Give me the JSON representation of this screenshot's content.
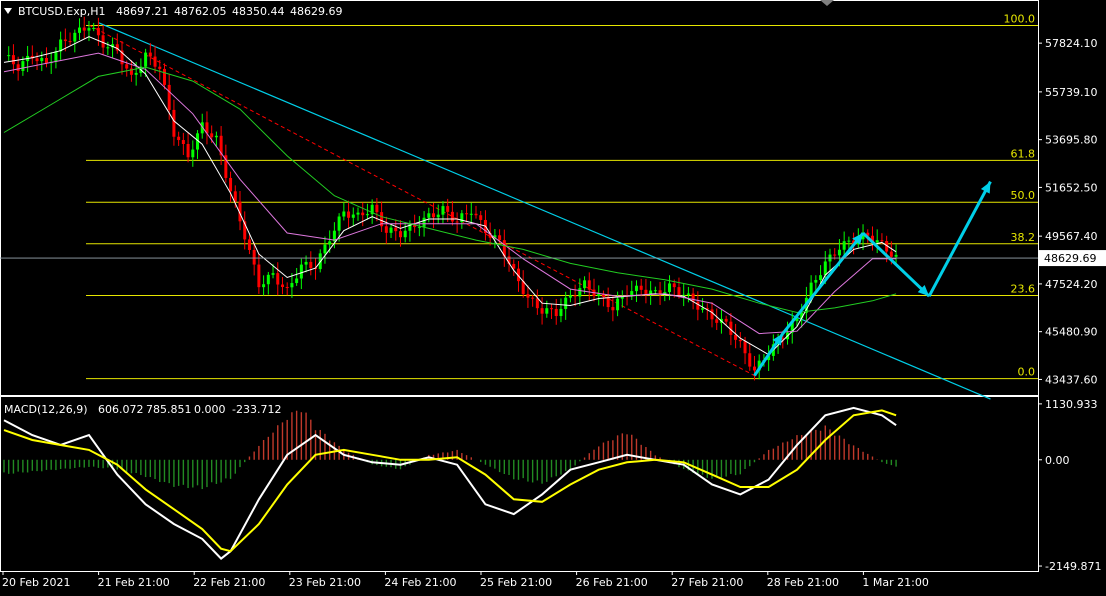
{
  "chart_data": [
    {
      "type": "candlestick",
      "symbol_header": "BTCUSD.Exp,H1",
      "ohlc": [
        "48697.21",
        "48762.05",
        "48350.44",
        "48629.69"
      ],
      "current_price": "48629.69",
      "price_axis_labels": [
        "57824.10",
        "55739.10",
        "53695.80",
        "51652.50",
        "49567.40",
        "47524.20",
        "45480.90",
        "43437.60"
      ],
      "ylim": [
        42900,
        58900
      ],
      "x_labels": [
        "20 Feb 2021",
        "21 Feb 21:00",
        "22 Feb 21:00",
        "23 Feb 21:00",
        "24 Feb 21:00",
        "25 Feb 21:00",
        "26 Feb 21:00",
        "27 Feb 21:00",
        "28 Feb 21:00",
        "1 Mar 21:00"
      ],
      "fibonacci": [
        {
          "label": "100.0",
          "price": 58580
        },
        {
          "label": "61.8",
          "price": 52810
        },
        {
          "label": "50.0",
          "price": 51020
        },
        {
          "label": "38.2",
          "price": 49240
        },
        {
          "label": "23.6",
          "price": 47030
        },
        {
          "label": "0.0",
          "price": 43470
        }
      ],
      "series": [
        {
          "name": "price",
          "points": [
            [
              0,
              57300
            ],
            [
              3,
              56800
            ],
            [
              6,
              57300
            ],
            [
              9,
              56900
            ],
            [
              12,
              57800
            ],
            [
              15,
              58200
            ],
            [
              18,
              58600
            ],
            [
              21,
              57800
            ],
            [
              24,
              57500
            ],
            [
              27,
              56300
            ],
            [
              30,
              57300
            ],
            [
              33,
              56800
            ],
            [
              36,
              54000
            ],
            [
              39,
              53000
            ],
            [
              42,
              54300
            ],
            [
              45,
              53700
            ],
            [
              48,
              51500
            ],
            [
              51,
              49600
            ],
            [
              54,
              47500
            ],
            [
              57,
              47900
            ],
            [
              60,
              47200
            ],
            [
              63,
              48300
            ],
            [
              66,
              48300
            ],
            [
              69,
              49500
            ],
            [
              72,
              50600
            ],
            [
              75,
              50400
            ],
            [
              78,
              50800
            ],
            [
              81,
              49800
            ],
            [
              84,
              49700
            ],
            [
              87,
              50000
            ],
            [
              90,
              50400
            ],
            [
              93,
              50700
            ],
            [
              96,
              50200
            ],
            [
              99,
              50700
            ],
            [
              102,
              49800
            ],
            [
              105,
              49300
            ],
            [
              108,
              48000
            ],
            [
              111,
              46900
            ],
            [
              114,
              46400
            ],
            [
              117,
              46300
            ],
            [
              120,
              47000
            ],
            [
              123,
              47500
            ],
            [
              126,
              47000
            ],
            [
              129,
              46500
            ],
            [
              132,
              47200
            ],
            [
              135,
              47300
            ],
            [
              138,
              47100
            ],
            [
              141,
              47400
            ],
            [
              144,
              47100
            ],
            [
              147,
              46600
            ],
            [
              150,
              46100
            ],
            [
              153,
              45800
            ],
            [
              156,
              44900
            ],
            [
              159,
              43800
            ],
            [
              162,
              44600
            ],
            [
              165,
              45300
            ],
            [
              168,
              46000
            ],
            [
              171,
              47400
            ],
            [
              174,
              48400
            ],
            [
              177,
              49100
            ],
            [
              180,
              49400
            ],
            [
              183,
              49600
            ],
            [
              186,
              49200
            ],
            [
              189,
              48630
            ]
          ]
        },
        {
          "name": "fast MA",
          "points": [
            [
              0,
              57000
            ],
            [
              6,
              57200
            ],
            [
              12,
              57500
            ],
            [
              18,
              58100
            ],
            [
              24,
              57600
            ],
            [
              30,
              56500
            ],
            [
              36,
              54500
            ],
            [
              42,
              53500
            ],
            [
              48,
              51400
            ],
            [
              54,
              48800
            ],
            [
              60,
              47800
            ],
            [
              66,
              48200
            ],
            [
              72,
              49800
            ],
            [
              78,
              50400
            ],
            [
              84,
              49900
            ],
            [
              90,
              50300
            ],
            [
              96,
              50300
            ],
            [
              102,
              50000
            ],
            [
              108,
              48100
            ],
            [
              114,
              46700
            ],
            [
              120,
              46600
            ],
            [
              126,
              46900
            ],
            [
              132,
              47000
            ],
            [
              138,
              47100
            ],
            [
              144,
              47000
            ],
            [
              150,
              46300
            ],
            [
              156,
              45200
            ],
            [
              162,
              44500
            ],
            [
              168,
              45700
            ],
            [
              174,
              47900
            ],
            [
              180,
              49000
            ],
            [
              186,
              49300
            ],
            [
              189,
              48900
            ]
          ]
        },
        {
          "name": "slow MA",
          "points": [
            [
              0,
              56600
            ],
            [
              10,
              57000
            ],
            [
              20,
              57400
            ],
            [
              30,
              56700
            ],
            [
              40,
              54800
            ],
            [
              50,
              52000
            ],
            [
              60,
              49700
            ],
            [
              70,
              49400
            ],
            [
              80,
              50100
            ],
            [
              90,
              50100
            ],
            [
              100,
              50100
            ],
            [
              110,
              48600
            ],
            [
              120,
              47300
            ],
            [
              130,
              47000
            ],
            [
              140,
              47100
            ],
            [
              150,
              46700
            ],
            [
              160,
              45400
            ],
            [
              168,
              45500
            ],
            [
              176,
              47200
            ],
            [
              184,
              48600
            ],
            [
              189,
              48600
            ]
          ]
        },
        {
          "name": "long MA",
          "points": [
            [
              0,
              54000
            ],
            [
              10,
              55200
            ],
            [
              20,
              56400
            ],
            [
              30,
              56800
            ],
            [
              40,
              56200
            ],
            [
              50,
              55000
            ],
            [
              60,
              53000
            ],
            [
              70,
              51300
            ],
            [
              80,
              50400
            ],
            [
              90,
              49900
            ],
            [
              100,
              49400
            ],
            [
              110,
              49000
            ],
            [
              120,
              48400
            ],
            [
              130,
              48000
            ],
            [
              140,
              47700
            ],
            [
              150,
              47300
            ],
            [
              160,
              46700
            ],
            [
              168,
              46300
            ],
            [
              176,
              46500
            ],
            [
              184,
              46800
            ],
            [
              189,
              47100
            ]
          ]
        }
      ],
      "trendlines": [
        {
          "from": [
            20,
            58700
          ],
          "to": [
            209,
            42600
          ]
        },
        {
          "from": [
            18,
            58600
          ],
          "to": [
            159,
            43600
          ]
        }
      ],
      "projection": [
        [
          159,
          43600
        ],
        [
          165,
          45400
        ],
        [
          182,
          49700
        ],
        [
          196,
          47000
        ],
        [
          209,
          51900
        ]
      ]
    },
    {
      "type": "bar",
      "name": "MACD(12,26,9)",
      "header_values": [
        "606.072",
        "785.851",
        "0.000",
        "-233.712"
      ],
      "axis_labels": [
        "1130.933",
        "0.00",
        "-2149.871"
      ],
      "ylim": [
        -2230,
        1250
      ],
      "histogram": [
        [
          0,
          -300
        ],
        [
          6,
          -250
        ],
        [
          12,
          -200
        ],
        [
          18,
          -150
        ],
        [
          24,
          -200
        ],
        [
          30,
          -350
        ],
        [
          36,
          -550
        ],
        [
          42,
          -600
        ],
        [
          48,
          -400
        ],
        [
          54,
          300
        ],
        [
          60,
          900
        ],
        [
          63,
          1100
        ],
        [
          66,
          700
        ],
        [
          72,
          200
        ],
        [
          78,
          -100
        ],
        [
          84,
          -200
        ],
        [
          90,
          100
        ],
        [
          96,
          200
        ],
        [
          102,
          -100
        ],
        [
          108,
          -400
        ],
        [
          114,
          -500
        ],
        [
          120,
          -200
        ],
        [
          126,
          300
        ],
        [
          132,
          600
        ],
        [
          138,
          100
        ],
        [
          144,
          -200
        ],
        [
          150,
          -400
        ],
        [
          156,
          -300
        ],
        [
          162,
          200
        ],
        [
          168,
          500
        ],
        [
          174,
          700
        ],
        [
          180,
          300
        ],
        [
          186,
          -50
        ],
        [
          189,
          -150
        ]
      ],
      "series": [
        {
          "name": "MACD",
          "points": [
            [
              0,
              800
            ],
            [
              6,
              500
            ],
            [
              12,
              300
            ],
            [
              18,
              500
            ],
            [
              24,
              -300
            ],
            [
              30,
              -900
            ],
            [
              36,
              -1300
            ],
            [
              42,
              -1600
            ],
            [
              46,
              -2000
            ],
            [
              48,
              -1850
            ],
            [
              54,
              -800
            ],
            [
              60,
              100
            ],
            [
              66,
              500
            ],
            [
              72,
              100
            ],
            [
              78,
              -50
            ],
            [
              84,
              -100
            ],
            [
              90,
              50
            ],
            [
              96,
              -100
            ],
            [
              102,
              -900
            ],
            [
              108,
              -1100
            ],
            [
              114,
              -700
            ],
            [
              120,
              -200
            ],
            [
              126,
              -50
            ],
            [
              132,
              100
            ],
            [
              138,
              0
            ],
            [
              144,
              -100
            ],
            [
              150,
              -500
            ],
            [
              156,
              -700
            ],
            [
              162,
              -400
            ],
            [
              168,
              300
            ],
            [
              174,
              900
            ],
            [
              180,
              1050
            ],
            [
              186,
              900
            ],
            [
              189,
              700
            ]
          ]
        },
        {
          "name": "Signal",
          "points": [
            [
              0,
              600
            ],
            [
              6,
              400
            ],
            [
              12,
              300
            ],
            [
              18,
              200
            ],
            [
              24,
              -100
            ],
            [
              30,
              -600
            ],
            [
              36,
              -1000
            ],
            [
              42,
              -1400
            ],
            [
              46,
              -1800
            ],
            [
              48,
              -1850
            ],
            [
              54,
              -1300
            ],
            [
              60,
              -500
            ],
            [
              66,
              100
            ],
            [
              72,
              200
            ],
            [
              78,
              100
            ],
            [
              84,
              0
            ],
            [
              90,
              0
            ],
            [
              96,
              50
            ],
            [
              102,
              -300
            ],
            [
              108,
              -800
            ],
            [
              114,
              -850
            ],
            [
              120,
              -500
            ],
            [
              126,
              -200
            ],
            [
              132,
              -50
            ],
            [
              138,
              0
            ],
            [
              144,
              -50
            ],
            [
              150,
              -300
            ],
            [
              156,
              -550
            ],
            [
              162,
              -550
            ],
            [
              168,
              -200
            ],
            [
              174,
              400
            ],
            [
              180,
              900
            ],
            [
              186,
              1000
            ],
            [
              189,
              900
            ]
          ]
        }
      ]
    }
  ],
  "colors": {
    "bull": "#00ff00",
    "bear": "#ff0000",
    "fib": "#e6e600",
    "trend": "#00cfe8",
    "macd_line": "#ffffff",
    "signal_line": "#ffff00",
    "hist_pos": "#c0392b",
    "hist_neg": "#228b22"
  }
}
